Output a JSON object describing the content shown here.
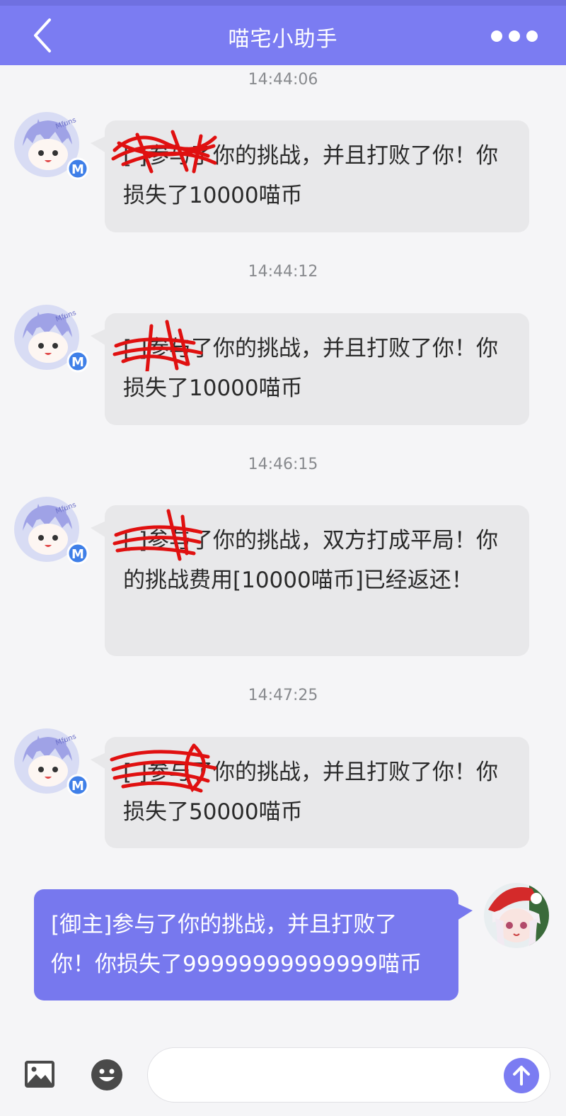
{
  "header": {
    "title": "喵宅小助手"
  },
  "messages": [
    {
      "time": "14:44:06",
      "text": "[  ]参与了你的挑战，并且打败了你！你损失了10000喵币"
    },
    {
      "time": "14:44:12",
      "text": "[  ]参与了你的挑战，并且打败了你！你损失了10000喵币"
    },
    {
      "time": "14:46:15",
      "text": "[  ]参与了你的挑战，双方打成平局！你的挑战费用[10000喵币]已经返还！"
    },
    {
      "time": "14:47:25",
      "text": "[  ]参与了你的挑战，并且打败了你！你损失了50000喵币"
    }
  ],
  "self_message": {
    "text": "[御主]参与了你的挑战，并且打败了你！你损失了99999999999999喵币"
  },
  "avatar_badge": "M",
  "avatar_text": "Mfuns",
  "input": {
    "value": "",
    "placeholder": ""
  },
  "colors": {
    "accent": "#7b7cf2",
    "bubble_in": "#e8e8ea",
    "bubble_out": "#7778ee",
    "redaction": "#e01010"
  },
  "icons": [
    "back-icon",
    "more-icon",
    "image-icon",
    "emoji-icon",
    "send-arrow-icon"
  ]
}
